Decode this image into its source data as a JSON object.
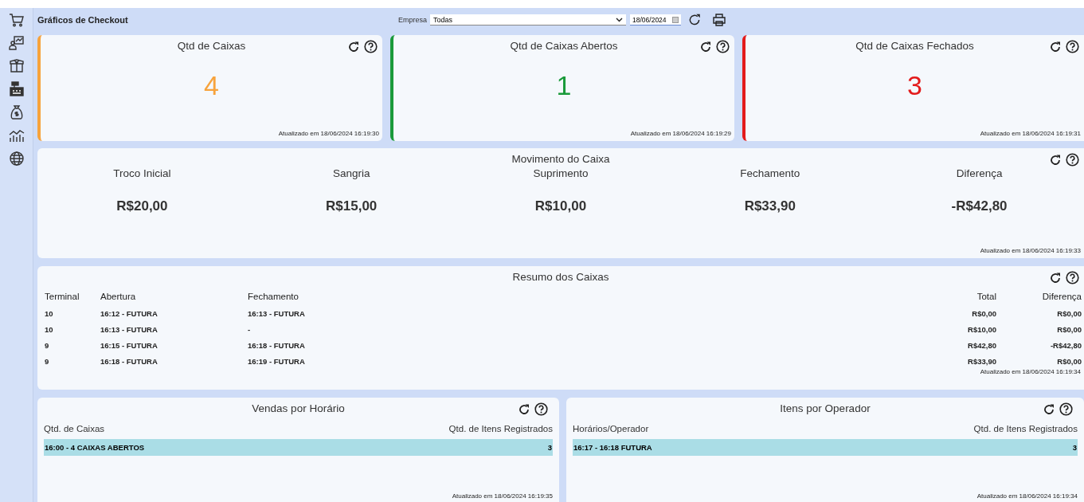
{
  "header": {
    "title": "Gráficos de Checkout",
    "empresa_label": "Empresa",
    "empresa_value": "Todas",
    "date_value": "18/06/2024"
  },
  "sidebar": {
    "items": [
      {
        "kind": "cart"
      },
      {
        "kind": "board"
      },
      {
        "kind": "box"
      },
      {
        "kind": "register"
      },
      {
        "kind": "bag"
      },
      {
        "kind": "chart"
      },
      {
        "kind": "globe"
      }
    ]
  },
  "summary_cards": [
    {
      "title": "Qtd de Caixas",
      "value": "4",
      "color": "#f7a33c",
      "updated": "Atualizado em 18/06/2024 16:19:30"
    },
    {
      "title": "Qtd de Caixas Abertos",
      "value": "1",
      "color": "#1a9a3a",
      "updated": "Atualizado em 18/06/2024 16:19:29"
    },
    {
      "title": "Qtd de Caixas Fechados",
      "value": "3",
      "color": "#e31b1b",
      "updated": "Atualizado em 18/06/2024 16:19:31"
    }
  ],
  "movimento": {
    "title": "Movimento do Caixa",
    "items": [
      {
        "label": "Troco Inicial",
        "value": "R$20,00"
      },
      {
        "label": "Sangria",
        "value": "R$15,00"
      },
      {
        "label": "Suprimento",
        "value": "R$10,00"
      },
      {
        "label": "Fechamento",
        "value": "R$33,90"
      },
      {
        "label": "Diferença",
        "value": "-R$42,80"
      }
    ],
    "updated": "Atualizado em 18/06/2024 16:19:33"
  },
  "resumo": {
    "title": "Resumo dos Caixas",
    "columns": [
      "Terminal",
      "Abertura",
      "Fechamento",
      "Total",
      "Diferença"
    ],
    "rows": [
      [
        "10",
        "16:12 - FUTURA",
        "16:13 - FUTURA",
        "R$0,00",
        "R$0,00"
      ],
      [
        "10",
        "16:13 - FUTURA",
        "-",
        "R$10,00",
        "R$0,00"
      ],
      [
        "9",
        "16:15 - FUTURA",
        "16:18 - FUTURA",
        "R$42,80",
        "-R$42,80"
      ],
      [
        "9",
        "16:18 - FUTURA",
        "16:19 - FUTURA",
        "R$33,90",
        "R$0,00"
      ]
    ],
    "updated": "Atualizado em 18/06/2024 16:19:34"
  },
  "bottom_panels": [
    {
      "title": "Vendas por Horário",
      "columns": [
        "Qtd. de Caixas",
        "Qtd. de Itens Registrados"
      ],
      "rows": [
        [
          "16:00 - 4 CAIXAS ABERTOS",
          "3"
        ]
      ],
      "updated": "Atualizado em 18/06/2024 16:19:35"
    },
    {
      "title": "Itens por Operador",
      "columns": [
        "Horários/Operador",
        "Qtd. de Itens Registrados"
      ],
      "rows": [
        [
          "16:17 - 16:18  FUTURA",
          "3"
        ]
      ],
      "updated": "Atualizado em 18/06/2024 16:19:34"
    }
  ]
}
